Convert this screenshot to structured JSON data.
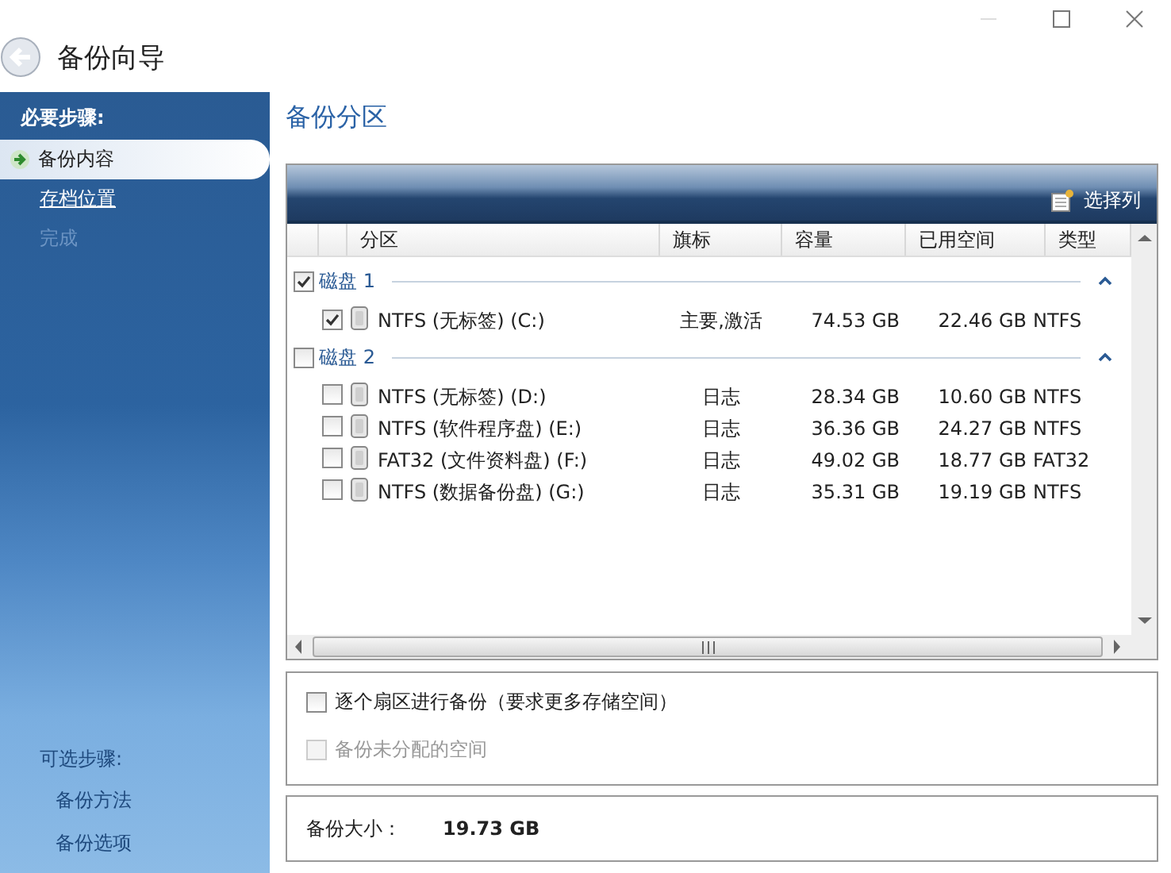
{
  "window": {
    "title": "备份向导"
  },
  "sidebar": {
    "required_header": "必要步骤:",
    "steps": [
      {
        "label": "备份内容",
        "kind": "current"
      },
      {
        "label": "存档位置",
        "kind": "link"
      },
      {
        "label": "完成",
        "kind": "disabled"
      }
    ],
    "optional_header": "可选步骤:",
    "optional_steps": [
      "备份方法",
      "备份选项"
    ]
  },
  "page_title": "备份分区",
  "toolbar": {
    "choose_columns": "选择列"
  },
  "table": {
    "columns": [
      "分区",
      "旗标",
      "容量",
      "已用空间",
      "类型"
    ],
    "groups": [
      {
        "name": "磁盘 1",
        "checked": true,
        "expanded": true,
        "rows": [
          {
            "partition": "NTFS (无标签) (C:)",
            "flags": "主要,激活",
            "capacity": "74.53 GB",
            "used": "22.46 GB",
            "type": "NTFS",
            "checked": true
          }
        ]
      },
      {
        "name": "磁盘 2",
        "checked": false,
        "expanded": true,
        "rows": [
          {
            "partition": "NTFS (无标签) (D:)",
            "flags": "日志",
            "capacity": "28.34 GB",
            "used": "10.60 GB",
            "type": "NTFS",
            "checked": false
          },
          {
            "partition": "NTFS (软件程序盘) (E:)",
            "flags": "日志",
            "capacity": "36.36 GB",
            "used": "24.27 GB",
            "type": "NTFS",
            "checked": false
          },
          {
            "partition": "FAT32 (文件资料盘) (F:)",
            "flags": "日志",
            "capacity": "49.02 GB",
            "used": "18.77 GB",
            "type": "FAT32",
            "checked": false
          },
          {
            "partition": "NTFS (数据备份盘) (G:)",
            "flags": "日志",
            "capacity": "35.31 GB",
            "used": "19.19 GB",
            "type": "NTFS",
            "checked": false
          }
        ]
      }
    ]
  },
  "options": [
    {
      "label": "逐个扇区进行备份（要求更多存储空间）",
      "checked": false,
      "disabled": false
    },
    {
      "label": "备份未分配的空间",
      "checked": false,
      "disabled": true
    }
  ],
  "summary": {
    "label": "备份大小：",
    "value": "19.73 GB"
  }
}
